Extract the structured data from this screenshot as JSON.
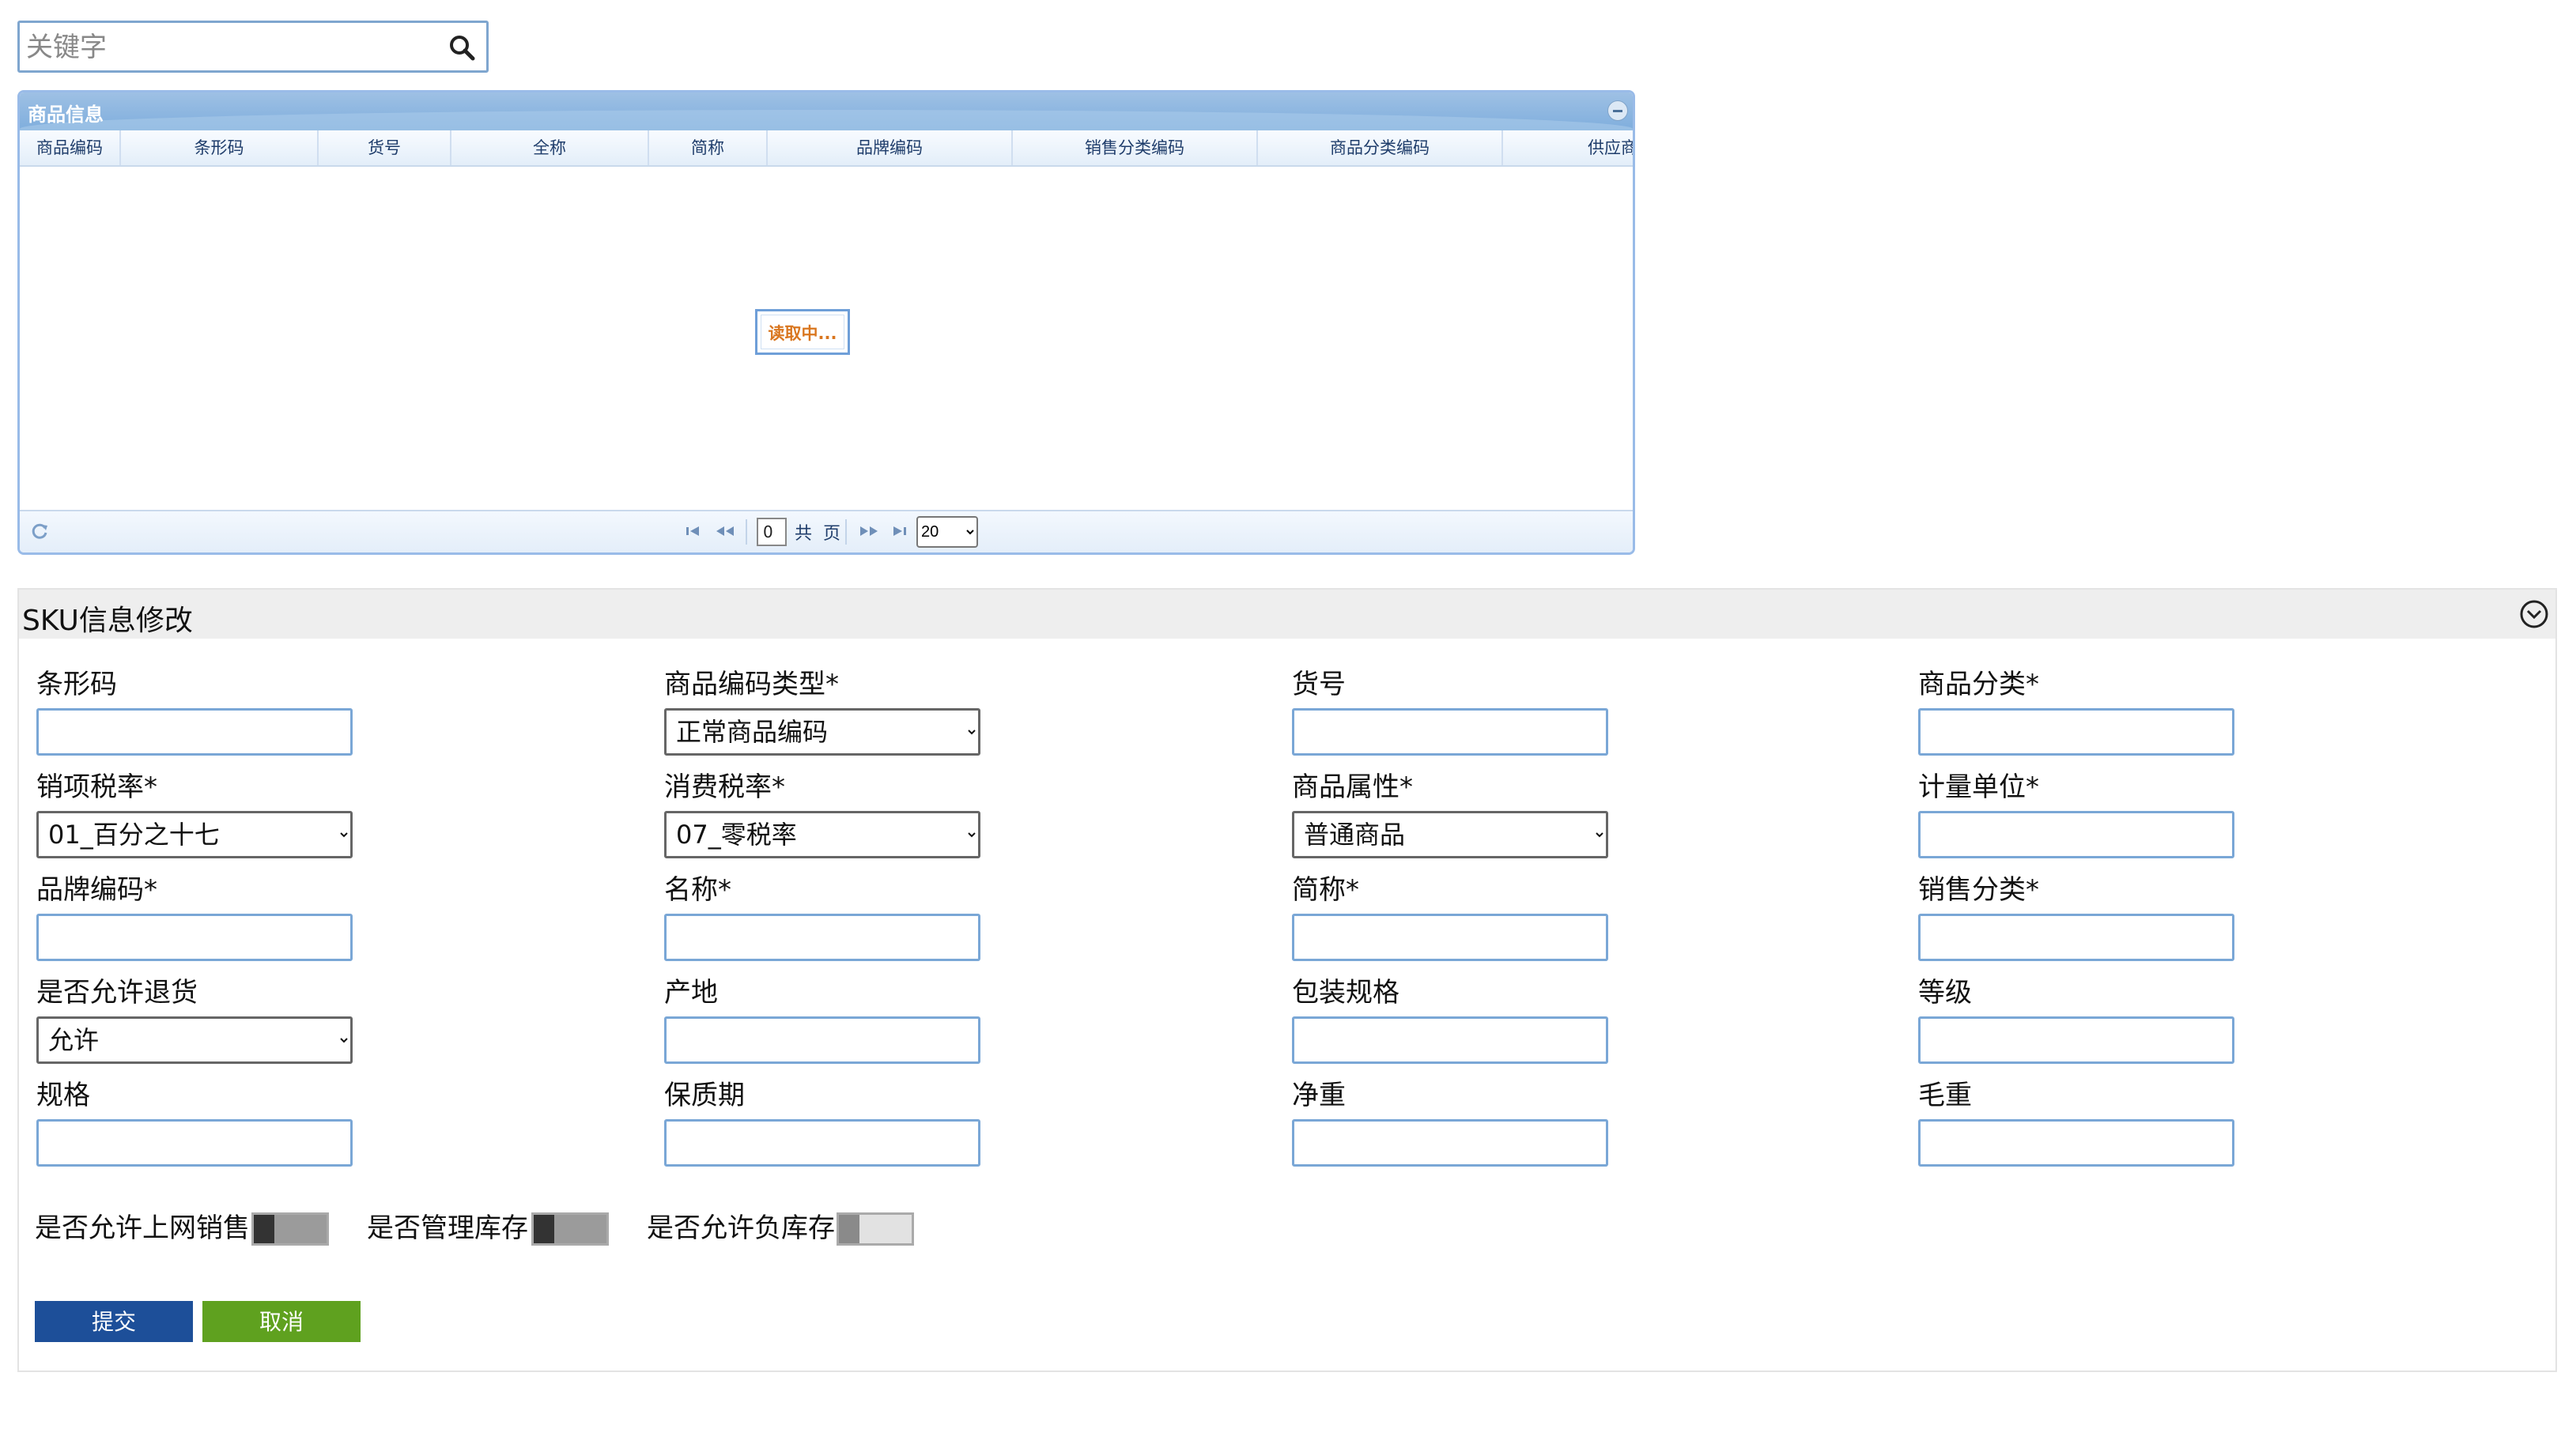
{
  "search": {
    "placeholder": "关键字"
  },
  "grid": {
    "title": "商品信息",
    "columns": [
      "商品编码",
      "条形码",
      "货号",
      "全称",
      "简称",
      "品牌编码",
      "销售分类编码",
      "商品分类编码",
      "供应商"
    ],
    "loading_text": "读取中...",
    "pager": {
      "page_value": "0",
      "total_prefix": "共",
      "total_suffix": "页",
      "page_size": "20"
    }
  },
  "sku_form": {
    "title": "SKU信息修改",
    "fields": [
      {
        "label": "条形码",
        "value": ""
      },
      {
        "label": "商品编码类型*",
        "value": "正常商品编码"
      },
      {
        "label": "货号",
        "value": ""
      },
      {
        "label": "商品分类*",
        "value": ""
      },
      {
        "label": "销项税率*",
        "value": "01_百分之十七"
      },
      {
        "label": "消费税率*",
        "value": "07_零税率"
      },
      {
        "label": "商品属性*",
        "value": "普通商品"
      },
      {
        "label": "计量单位*",
        "value": ""
      },
      {
        "label": "品牌编码*",
        "value": ""
      },
      {
        "label": "名称*",
        "value": ""
      },
      {
        "label": "简称*",
        "value": ""
      },
      {
        "label": "销售分类*",
        "value": ""
      },
      {
        "label": "是否允许退货",
        "value": "允许"
      },
      {
        "label": "产地",
        "value": ""
      },
      {
        "label": "包装规格",
        "value": ""
      },
      {
        "label": "等级",
        "value": ""
      },
      {
        "label": "规格",
        "value": ""
      },
      {
        "label": "保质期",
        "value": ""
      },
      {
        "label": "净重",
        "value": ""
      },
      {
        "label": "毛重",
        "value": ""
      }
    ],
    "toggles": [
      {
        "label": "是否允许上网销售"
      },
      {
        "label": "是否管理库存"
      },
      {
        "label": "是否允许负库存"
      }
    ],
    "submit_label": "提交",
    "cancel_label": "取消"
  },
  "colors": {
    "submit": "#1d4f99",
    "cancel": "#5fa11f",
    "panel_header": "#8fb5e1"
  }
}
